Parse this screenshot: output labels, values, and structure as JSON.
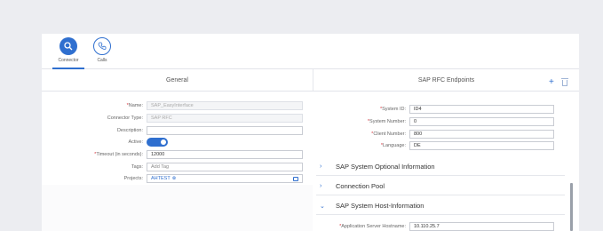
{
  "tabs": [
    {
      "label": "Connector",
      "icon": "connector-icon",
      "active": true
    },
    {
      "label": "Calls",
      "icon": "phone-icon",
      "active": false
    }
  ],
  "general": {
    "title": "General",
    "fields": {
      "name": {
        "label": "Name:",
        "value": "SAP_EasyInterface",
        "required": true
      },
      "connector_type": {
        "label": "Connector Type:",
        "value": "SAP RFC"
      },
      "description": {
        "label": "Description:",
        "value": ""
      },
      "active": {
        "label": "Active:",
        "value": "on"
      },
      "timeout": {
        "label": "Timeout (in seconds):",
        "value": "12000",
        "required": true
      },
      "tags": {
        "label": "Tags:",
        "placeholder": "Add Tag"
      },
      "projects": {
        "label": "Projects:",
        "value": "AHTEST",
        "chip_close": "⊗"
      }
    }
  },
  "rfc": {
    "title": "SAP RFC Endpoints",
    "add_icon": "+",
    "fields": {
      "system_id": {
        "label": "System ID:",
        "value": "ID4",
        "required": true
      },
      "system_number": {
        "label": "System Number:",
        "value": "0",
        "required": true
      },
      "client_number": {
        "label": "Client Number:",
        "value": "800",
        "required": true
      },
      "language": {
        "label": "Language:",
        "value": "DE",
        "required": true
      }
    },
    "sections": [
      {
        "label": "SAP System Optional Information",
        "chevron": "›",
        "expanded": false
      },
      {
        "label": "Connection Pool",
        "chevron": "›",
        "expanded": false
      },
      {
        "label": "SAP System Host-Information",
        "chevron": "⌄",
        "expanded": true
      }
    ],
    "host": {
      "label": "Application Server Hostname:",
      "value": "10.110.25.7",
      "required": true
    }
  },
  "colors": {
    "accent": "#2f6fcf",
    "required": "#d9363e"
  }
}
